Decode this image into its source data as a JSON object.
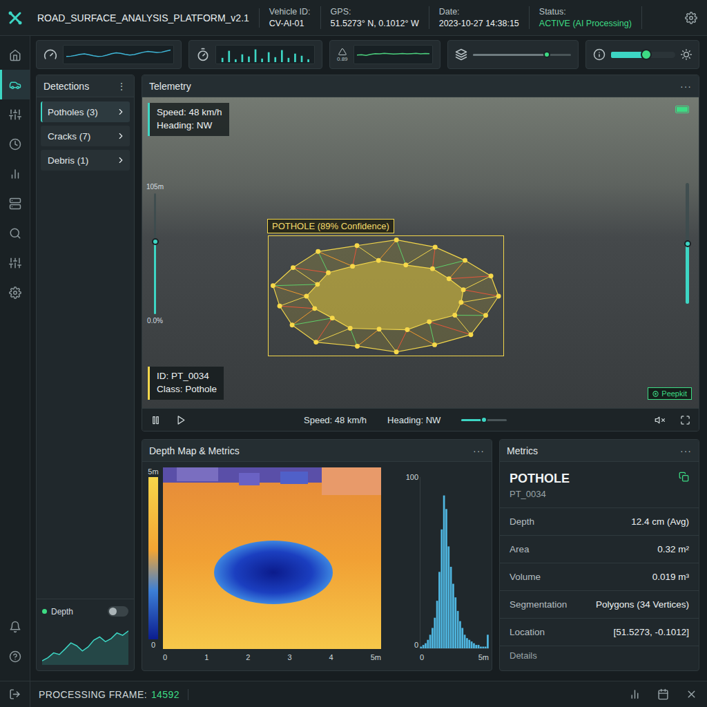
{
  "header": {
    "title": "ROAD_SURFACE_ANALYSIS_PLATFORM_v2.1",
    "fields": [
      {
        "label": "Vehicle ID:",
        "value": "CV-AI-01",
        "kind": "plain"
      },
      {
        "label": "GPS:",
        "value": "51.5273° N, 0.1012° W",
        "kind": "plain"
      },
      {
        "label": "Date:",
        "value": "2023-10-27 14:38:15",
        "kind": "plain"
      },
      {
        "label": "Status:",
        "value": "ACTIVE (AI Processing)",
        "kind": "status"
      }
    ]
  },
  "nav": [
    {
      "selected": false
    },
    {
      "selected": true
    },
    {
      "selected": false
    },
    {
      "selected": false
    },
    {
      "selected": false
    },
    {
      "selected": false
    },
    {
      "selected": false
    },
    {
      "selected": false
    },
    {
      "selected": false
    }
  ],
  "toolbar": [
    {
      "kind": "line",
      "values": [
        40,
        42,
        48,
        55,
        58,
        52,
        45,
        40,
        42,
        50,
        60,
        66,
        62,
        55,
        50,
        54,
        62,
        70,
        75,
        72,
        68,
        70,
        78,
        85
      ]
    },
    {
      "kind": "bars",
      "values": [
        30,
        80,
        20,
        55,
        40,
        90,
        25,
        70,
        35,
        85,
        30,
        60,
        45,
        20
      ]
    },
    {
      "kind": "line",
      "label": "0.89",
      "values": [
        50,
        52,
        48,
        55,
        60,
        58,
        62,
        60,
        57,
        59,
        61,
        58,
        60,
        62,
        59,
        61,
        60
      ]
    },
    {
      "kind": "slider",
      "level": 0.75
    },
    {
      "kind": "toggle",
      "level": 0.55
    }
  ],
  "detections": {
    "title": "Detections",
    "menu": "⋮",
    "items": [
      {
        "label": "Potholes (3)",
        "selected": true
      },
      {
        "label": "Cracks (7)",
        "selected": false
      },
      {
        "label": "Debris (1)",
        "selected": false
      }
    ],
    "depth": {
      "label": "Depth",
      "on": false,
      "values": [
        10,
        18,
        30,
        26,
        40,
        55,
        48,
        35,
        45,
        62,
        70,
        58,
        66,
        80,
        74,
        85
      ]
    }
  },
  "telemetry": {
    "title": "Telemetry",
    "menu": "···",
    "overlay": {
      "speed": "Speed: 48 km/h",
      "heading": "Heading: NW",
      "scale_top": "105m",
      "scale_bottom": "0.0%",
      "scale_level": 0.6,
      "right_level": 0.5,
      "label": "POTHOLE (89% Confidence)",
      "id": "ID: PT_0034",
      "class": "Class: Pothole",
      "badge": "Peepkit",
      "battery": 1
    },
    "controls": {
      "speed": "Speed: 48 km/h",
      "heading": "Heading: NW",
      "level": 0.5,
      "muted": true
    }
  },
  "depth_map": {
    "title": "Depth Map & Metrics",
    "menu": "···",
    "colorbar_top": "5m",
    "colorbar_bottom": "0",
    "x_ticks": [
      "0",
      "1",
      "2",
      "3",
      "4",
      "5m"
    ],
    "histogram": {
      "y_top": "100",
      "y_bottom": "0",
      "x_left": "0",
      "x_right": "5m",
      "max": 100,
      "values": [
        1,
        2,
        3,
        5,
        8,
        12,
        18,
        28,
        45,
        70,
        90,
        82,
        60,
        48,
        38,
        30,
        22,
        16,
        12,
        8,
        6,
        5,
        4,
        3,
        2,
        2,
        1,
        1,
        1,
        8
      ]
    }
  },
  "metrics": {
    "title": "Metrics",
    "menu": "···",
    "heading": "POTHOLE",
    "id": "PT_0034",
    "rows": [
      {
        "label": "Depth",
        "value": "12.4 cm (Avg)"
      },
      {
        "label": "Area",
        "value": "0.32 m²"
      },
      {
        "label": "Volume",
        "value": "0.019 m³"
      },
      {
        "label": "Segmentation",
        "value": "Polygons (34 Vertices)"
      },
      {
        "label": "Location",
        "value": "[51.5273, -0.1012]"
      }
    ],
    "more": "Details"
  },
  "footer": {
    "label": "PROCESSING FRAME:",
    "value": "14592"
  }
}
